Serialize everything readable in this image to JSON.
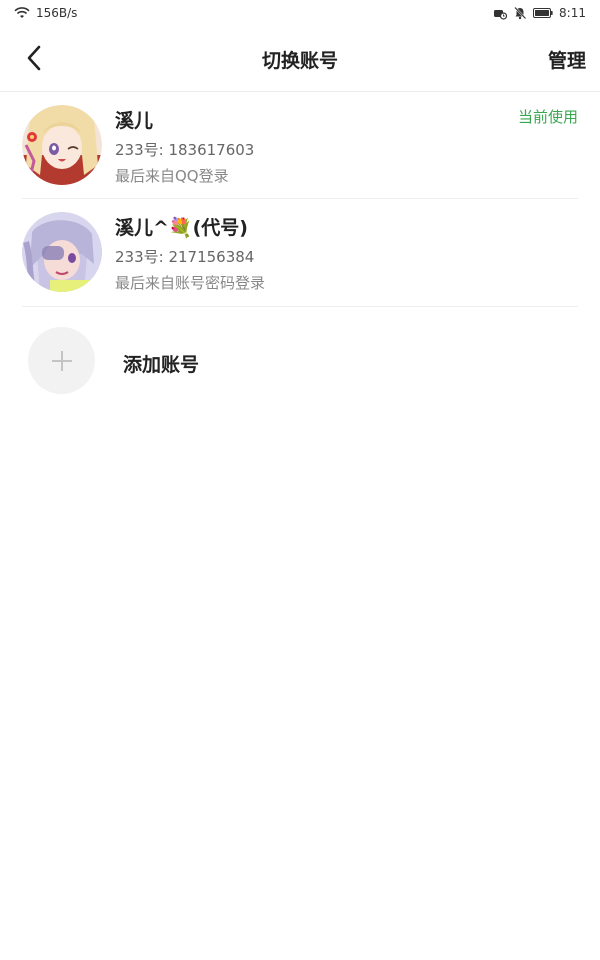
{
  "status_bar": {
    "network_speed": "156B/s",
    "time": "8:11",
    "icons": [
      "wifi-icon",
      "vpn-icon",
      "mute-icon",
      "battery-icon"
    ]
  },
  "header": {
    "title": "切换账号",
    "manage_label": "管理",
    "back_icon": "chevron-left-icon"
  },
  "accounts": [
    {
      "name": "溪儿",
      "id_text": "233号: 183617603",
      "login_text": "最后来自QQ登录",
      "badge": "当前使用"
    },
    {
      "name": "溪儿^💐(代号)",
      "id_text": "233号: 217156384",
      "login_text": "最后来自账号密码登录"
    }
  ],
  "add_account": {
    "label": "添加账号",
    "icon": "plus-icon"
  },
  "colors": {
    "accent_green": "#3aa652",
    "text_primary": "#222222",
    "text_secondary": "#666666",
    "divider": "#eeeeee"
  }
}
